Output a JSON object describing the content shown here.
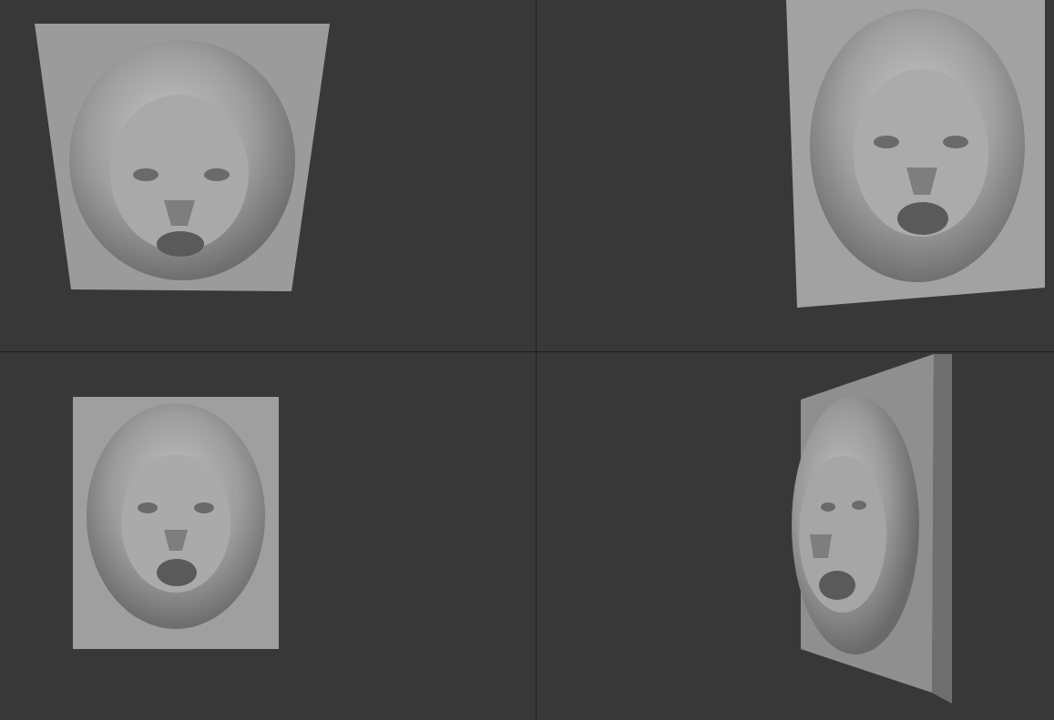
{
  "viewports": [
    {
      "id": "top-left",
      "view": "perspective-tilted-top"
    },
    {
      "id": "top-right",
      "view": "perspective-tilted-right"
    },
    {
      "id": "bottom-left",
      "view": "front"
    },
    {
      "id": "bottom-right",
      "view": "perspective-side"
    }
  ],
  "model": {
    "subject": "lion-head-relief",
    "plate_color": "#9a9a9a",
    "relief_color": "#b0b0b0",
    "background_color": "#383838"
  }
}
